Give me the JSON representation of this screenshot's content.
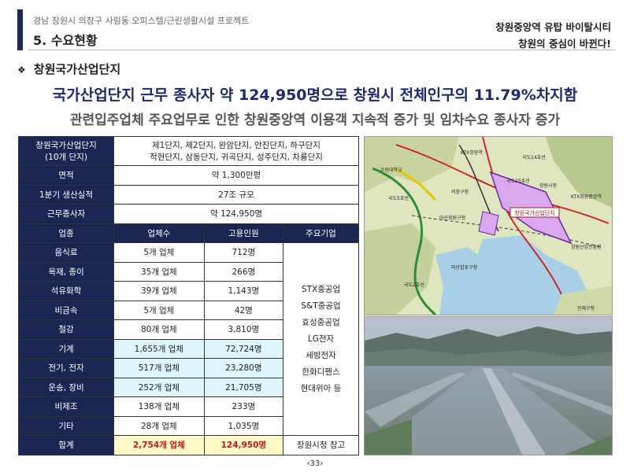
{
  "header": {
    "project": "경남 창원시 의창구 사림동 오피스텔/근린생활시설 프로젝트",
    "section_title": "5. 수요현황",
    "tagline_1": "창원중앙역 유탑 바이탈시티",
    "tagline_2": "창원의 중심이 바뀐다!"
  },
  "section": {
    "bullet": "❖",
    "title": "창원국가산업단지"
  },
  "headline": "국가산업단지 근무 종사자 약 124,950명으로 창원시 전체인구의 11.79%차지함",
  "subline": "관련입주업체  주요업무로 인한 창원중앙역 이용객 지속적 증가 및 임차수요 종사자 증가",
  "info_rows": [
    {
      "label_1": "창원국가산업단지",
      "label_2": "(10개 단지)",
      "value_1": "제1단지, 제2단지, 완암단지, 안진단지, 하구단지",
      "value_2": "적현단지, 삼동단지, 귀곡단지, 성주단지, 차룡단지"
    },
    {
      "label": "면적",
      "value": "약 1,300만평"
    },
    {
      "label": "1분기 생산실적",
      "value": "27조 규모"
    },
    {
      "label": "근무종사자",
      "value": "약 124,950명"
    }
  ],
  "table_headers": [
    "업종",
    "업체수",
    "고용인원",
    "주요기업"
  ],
  "industries": [
    {
      "name": "음식료",
      "count": "5개 업체",
      "employees": "712명"
    },
    {
      "name": "목재, 종이",
      "count": "35개 업체",
      "employees": "266명"
    },
    {
      "name": "석유화학",
      "count": "39개 업체",
      "employees": "1,143명"
    },
    {
      "name": "비금속",
      "count": "5개 업체",
      "employees": "42명"
    },
    {
      "name": "철강",
      "count": "80개 업체",
      "employees": "3,810명"
    },
    {
      "name": "기계",
      "count": "1,655개 업체",
      "employees": "72,724명"
    },
    {
      "name": "전기, 전자",
      "count": "517개 업체",
      "employees": "23,280명"
    },
    {
      "name": "운송, 장비",
      "count": "252개 업체",
      "employees": "21,705명"
    },
    {
      "name": "비제조",
      "count": "138개 업체",
      "employees": "233명"
    },
    {
      "name": "기타",
      "count": "28개 업체",
      "employees": "1,035명"
    }
  ],
  "major_companies": [
    "STX중공업",
    "S&T중공업",
    "효성중공업",
    "LG전자",
    "세방전자",
    "한화디펜스",
    "현대위아 등"
  ],
  "total": {
    "label": "합계",
    "count": "2,754개 업체",
    "employees": "124,950명",
    "note": "창원시청 참고"
  },
  "map": {
    "complex_label": "창원국가산업단지",
    "labels": [
      "수원대학교",
      "KTX창원역",
      "국도14호선",
      "국도25호선",
      "창원시청",
      "KTX창원중앙역",
      "국도5호선",
      "의창구청",
      "국도2호선",
      "진해구청",
      "마산회원구청",
      "마산합포구청",
      "창원산업진흥원"
    ]
  },
  "page_number": "‹33›",
  "colors": {
    "navy": "#1b2752",
    "cyan_cell": "#dcf6fb",
    "yellow_cell": "#fff9c8",
    "red_text": "#d01010",
    "headline": "#1e2870"
  }
}
